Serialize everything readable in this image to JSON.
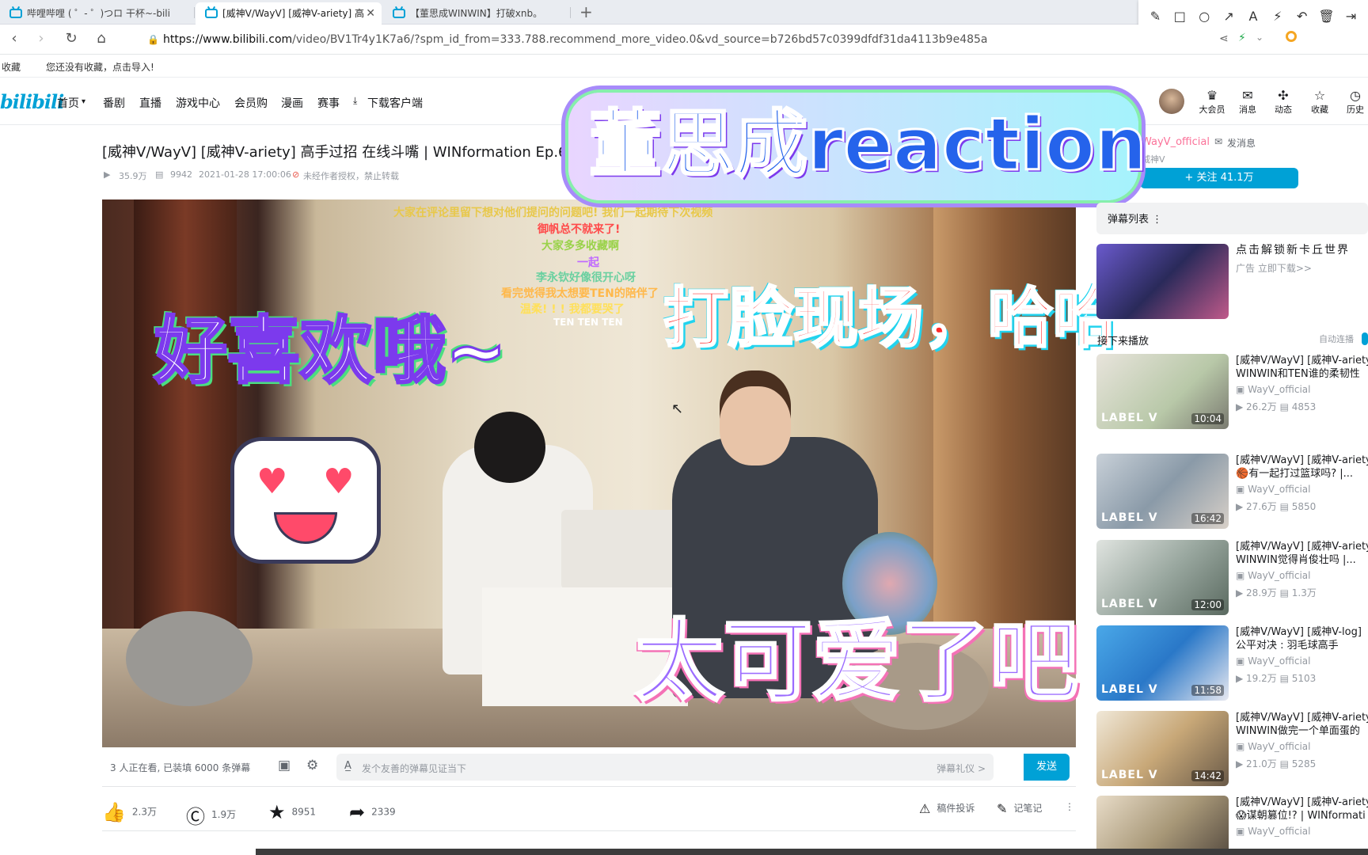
{
  "browser": {
    "tabs": [
      {
        "label": "哔哩哔哩 ( ゜- ゜)つロ 干杯~-bili"
      },
      {
        "label": "[威神V/WayV] [威神V-ariety] 高"
      },
      {
        "label": "【董思成WINWIN】打破xnb。"
      }
    ],
    "new_tab": "+",
    "url_host": "https://www.bilibili.com",
    "url_path": "/video/BV1Tr4y1K7a6/?spm_id_from=333.788.recommend_more_video.0&vd_source=b726bd57c0399dfdf31da4113b9e485a",
    "bookmarks_label": "收藏",
    "bookmarks_hint": "您还没有收藏，点击导入!"
  },
  "site": {
    "logo": "bilibili",
    "nav": [
      "首页",
      "番剧",
      "直播",
      "游戏中心",
      "会员购",
      "漫画",
      "赛事",
      "下载客户端"
    ],
    "right_icons": [
      {
        "icon": "crown-icon",
        "label": "大会员"
      },
      {
        "icon": "mail-icon",
        "label": "消息"
      },
      {
        "icon": "wind-icon",
        "label": "动态"
      },
      {
        "icon": "star-icon",
        "label": "收藏"
      },
      {
        "icon": "clock-icon",
        "label": "历史"
      }
    ]
  },
  "video": {
    "title": "[威神V/WayV] [威神V-ariety] 高手过招 在线斗嘴 | WINformation Ep.6-",
    "views": "35.9万",
    "danmaku_count": "9942",
    "date": "2021-01-28 17:00:06",
    "copyright": "未经作者授权，禁止转载"
  },
  "uploader": {
    "name": "WayV_official",
    "message": "发消息",
    "desc": "威神V",
    "follow": "+ 关注 41.1万"
  },
  "overlay": {
    "headline": "董思成reaction",
    "caption_left": "好喜欢哦~",
    "caption_right": "打脸现场，哈哈",
    "caption_bottom": "太可爱了吧"
  },
  "danmaku": [
    {
      "text": "大家在评论里留下想对他们提问的问题吧! 我们一起期待下次视频",
      "color": "#e8c84a"
    },
    {
      "text": "御帆总不就来了!",
      "color": "#ff4a4a"
    },
    {
      "text": "大家多多收藏啊",
      "color": "#9ad24a"
    },
    {
      "text": "一起",
      "color": "#c06aff"
    },
    {
      "text": "李永钦好像很开心呀",
      "color": "#6ad0a0"
    },
    {
      "text": "看完觉得我太想要TEN的陪伴了",
      "color": "#ffb84a"
    },
    {
      "text": "温柔! ! ! 我都要哭了",
      "color": "#ffe05a"
    },
    {
      "text": "TEN TEN TEN",
      "color": "#ffffff"
    }
  ],
  "player_bar": {
    "watching": "3 人正在看, 已装填 6000 条弹幕",
    "placeholder": "发个友善的弹幕见证当下",
    "etiquette": "弹幕礼仪 >",
    "send": "发送"
  },
  "actions": {
    "likes": "2.3万",
    "coins": "1.9万",
    "favorites": "8951",
    "shares": "2339",
    "report": "稿件投诉",
    "notes": "记笔记"
  },
  "sidebar": {
    "danmaku_list": "弹幕列表",
    "ad_title": "点击解锁新卡丘世界",
    "ad_sub": "广告  立即下载>>",
    "next_label": "接下来播放",
    "autoplay": "自动连播",
    "videos": [
      {
        "title": "[威神V/WayV] [威神V-ariety]",
        "sub": "WINWIN和TEN谁的柔韧性",
        "uploader": "WayV_official",
        "views": "26.2万",
        "danmaku": "4853",
        "duration": "10:04"
      },
      {
        "title": "[威神V/WayV] [威神V-ariety]",
        "sub": "有一起打过篮球吗? |...",
        "uploader": "WayV_official",
        "views": "27.6万",
        "danmaku": "5850",
        "duration": "16:42"
      },
      {
        "title": "[威神V/WayV] [威神V-ariety]",
        "sub": "WINWIN觉得肖俊壮吗 |...",
        "uploader": "WayV_official",
        "views": "28.9万",
        "danmaku": "1.3万",
        "duration": "12:00"
      },
      {
        "title": "[威神V/WayV] [威神V-log]",
        "sub": "公平对决 : 羽毛球高手",
        "uploader": "WayV_official",
        "views": "19.2万",
        "danmaku": "5103",
        "duration": "11:58"
      },
      {
        "title": "[威神V/WayV] [威神V-ariety]",
        "sub": "WINWIN做完一个单面蛋的",
        "uploader": "WayV_official",
        "views": "21.0万",
        "danmaku": "5285",
        "duration": "14:42"
      },
      {
        "title": "[威神V/WayV] [威神V-ariety]",
        "sub": "谋朝篡位!? | WINformati",
        "uploader": "WayV_official",
        "views": "",
        "danmaku": "",
        "duration": ""
      }
    ],
    "label_text": "LABEL V"
  },
  "colors": {
    "brand": "#00a1d6",
    "text": "#18191c",
    "muted": "#9499a0"
  }
}
